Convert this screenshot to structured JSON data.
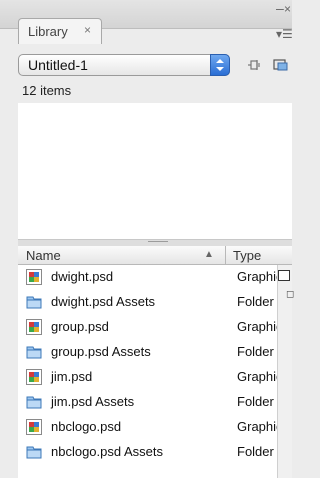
{
  "panel": {
    "tab_label": "Library",
    "tab_close": "×",
    "document_selected": "Untitled-1",
    "items_count": "12 items"
  },
  "list": {
    "columns": {
      "name": "Name",
      "type": "Type"
    },
    "rows": [
      {
        "name": "dwight.psd",
        "type": "Graphic",
        "icon": "graphic-icon"
      },
      {
        "name": "dwight.psd Assets",
        "type": "Folder",
        "icon": "folder-icon"
      },
      {
        "name": "group.psd",
        "type": "Graphic",
        "icon": "graphic-icon"
      },
      {
        "name": "group.psd Assets",
        "type": "Folder",
        "icon": "folder-icon"
      },
      {
        "name": "jim.psd",
        "type": "Graphic",
        "icon": "graphic-icon"
      },
      {
        "name": "jim.psd Assets",
        "type": "Folder",
        "icon": "folder-icon"
      },
      {
        "name": "nbclogo.psd",
        "type": "Graphic",
        "icon": "graphic-icon"
      },
      {
        "name": "nbclogo.psd Assets",
        "type": "Folder",
        "icon": "folder-icon"
      }
    ]
  },
  "colors": {
    "accent_blue": "#2a6ed4",
    "folder_blue": "#7fb2e6"
  }
}
